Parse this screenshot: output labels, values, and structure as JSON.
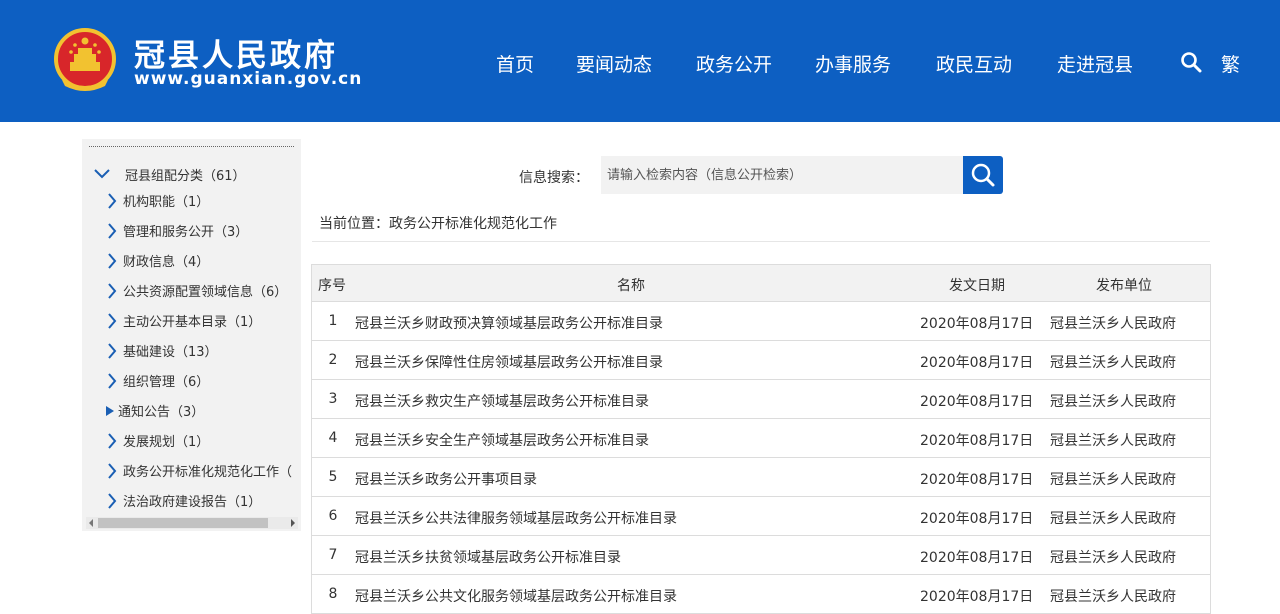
{
  "header": {
    "site_title": "冠县人民政府",
    "site_domain": "www.guanxian.gov.cn",
    "nav": [
      "首页",
      "要闻动态",
      "政务公开",
      "办事服务",
      "政民互动",
      "走进冠县"
    ],
    "traditional_label": "繁",
    "brand_color": "#0d5fc2"
  },
  "sidebar": {
    "root_label": "冠县组配分类（61）",
    "items": [
      {
        "label": "机构职能（1）",
        "icon": "chevron-right"
      },
      {
        "label": "管理和服务公开（3）",
        "icon": "chevron-right"
      },
      {
        "label": "财政信息（4）",
        "icon": "chevron-right"
      },
      {
        "label": "公共资源配置领域信息（6）",
        "icon": "chevron-right"
      },
      {
        "label": "主动公开基本目录（1）",
        "icon": "chevron-right"
      },
      {
        "label": "基础建设（13）",
        "icon": "chevron-right"
      },
      {
        "label": "组织管理（6）",
        "icon": "chevron-right"
      },
      {
        "label": "通知公告（3）",
        "icon": "triangle-right"
      },
      {
        "label": "发展规划（1）",
        "icon": "chevron-right"
      },
      {
        "label": "政务公开标准化规范化工作（",
        "icon": "chevron-right"
      },
      {
        "label": "法治政府建设报告（1）",
        "icon": "chevron-right"
      }
    ]
  },
  "search": {
    "label": "信息搜索：",
    "placeholder": "请输入检索内容（信息公开检索）"
  },
  "breadcrumb": "当前位置：政务公开标准化规范化工作",
  "table": {
    "headers": {
      "num": "序号",
      "title": "名称",
      "date": "发文日期",
      "unit": "发布单位"
    },
    "rows": [
      {
        "num": "1",
        "title": "冠县兰沃乡财政预决算领域基层政务公开标准目录",
        "date": "2020年08月17日",
        "unit": "冠县兰沃乡人民政府"
      },
      {
        "num": "2",
        "title": "冠县兰沃乡保障性住房领域基层政务公开标准目录",
        "date": "2020年08月17日",
        "unit": "冠县兰沃乡人民政府"
      },
      {
        "num": "3",
        "title": "冠县兰沃乡救灾生产领域基层政务公开标准目录",
        "date": "2020年08月17日",
        "unit": "冠县兰沃乡人民政府"
      },
      {
        "num": "4",
        "title": "冠县兰沃乡安全生产领域基层政务公开标准目录",
        "date": "2020年08月17日",
        "unit": "冠县兰沃乡人民政府"
      },
      {
        "num": "5",
        "title": "冠县兰沃乡政务公开事项目录",
        "date": "2020年08月17日",
        "unit": "冠县兰沃乡人民政府"
      },
      {
        "num": "6",
        "title": "冠县兰沃乡公共法律服务领域基层政务公开标准目录",
        "date": "2020年08月17日",
        "unit": "冠县兰沃乡人民政府"
      },
      {
        "num": "7",
        "title": "冠县兰沃乡扶贫领域基层政务公开标准目录",
        "date": "2020年08月17日",
        "unit": "冠县兰沃乡人民政府"
      },
      {
        "num": "8",
        "title": "冠县兰沃乡公共文化服务领域基层政务公开标准目录",
        "date": "2020年08月17日",
        "unit": "冠县兰沃乡人民政府"
      }
    ]
  }
}
